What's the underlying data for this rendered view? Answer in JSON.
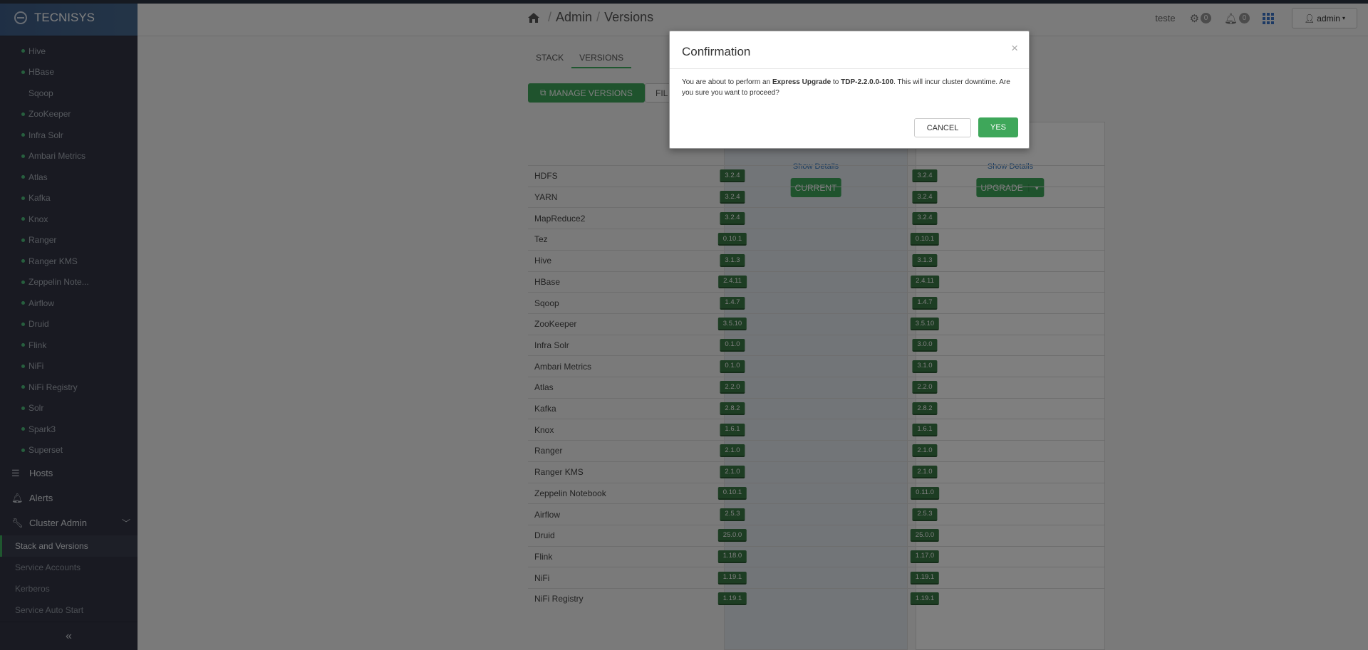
{
  "brand": {
    "name": "TECNISYS"
  },
  "sidebar": {
    "services": [
      {
        "label": "Hive",
        "dot": true
      },
      {
        "label": "HBase",
        "dot": true
      },
      {
        "label": "Sqoop",
        "dot": false
      },
      {
        "label": "ZooKeeper",
        "dot": true
      },
      {
        "label": "Infra Solr",
        "dot": true
      },
      {
        "label": "Ambari Metrics",
        "dot": true
      },
      {
        "label": "Atlas",
        "dot": true
      },
      {
        "label": "Kafka",
        "dot": true
      },
      {
        "label": "Knox",
        "dot": true
      },
      {
        "label": "Ranger",
        "dot": true
      },
      {
        "label": "Ranger KMS",
        "dot": true
      },
      {
        "label": "Zeppelin Note...",
        "dot": true
      },
      {
        "label": "Airflow",
        "dot": true
      },
      {
        "label": "Druid",
        "dot": true
      },
      {
        "label": "Flink",
        "dot": true
      },
      {
        "label": "NiFi",
        "dot": true
      },
      {
        "label": "NiFi Registry",
        "dot": true
      },
      {
        "label": "Solr",
        "dot": true
      },
      {
        "label": "Spark3",
        "dot": true
      },
      {
        "label": "Superset",
        "dot": true
      }
    ],
    "hosts": "Hosts",
    "alerts": "Alerts",
    "cluster_admin": "Cluster Admin",
    "cluster_admin_items": [
      "Stack and Versions",
      "Service Accounts",
      "Kerberos",
      "Service Auto Start"
    ],
    "collapse_icon": "double-chevron-left-icon"
  },
  "topbar": {
    "breadcrumb": [
      "Admin",
      "Versions"
    ],
    "username": "teste",
    "ops_count": "0",
    "alerts_count": "0",
    "admin_label": "admin"
  },
  "tabs": [
    "STACK",
    "VERSIONS"
  ],
  "manage_versions": "MANAGE VERSIONS",
  "filter_label": "FIL",
  "columns": {
    "current": {
      "show_details": "Show Details",
      "button": "CURRENT"
    },
    "upgrade": {
      "show_details": "Show Details",
      "button": "UPGRADE"
    }
  },
  "rows": [
    {
      "service": "HDFS",
      "current": "3.2.4",
      "upgrade": "3.2.4"
    },
    {
      "service": "YARN",
      "current": "3.2.4",
      "upgrade": "3.2.4"
    },
    {
      "service": "MapReduce2",
      "current": "3.2.4",
      "upgrade": "3.2.4"
    },
    {
      "service": "Tez",
      "current": "0.10.1",
      "upgrade": "0.10.1"
    },
    {
      "service": "Hive",
      "current": "3.1.3",
      "upgrade": "3.1.3"
    },
    {
      "service": "HBase",
      "current": "2.4.11",
      "upgrade": "2.4.11"
    },
    {
      "service": "Sqoop",
      "current": "1.4.7",
      "upgrade": "1.4.7"
    },
    {
      "service": "ZooKeeper",
      "current": "3.5.10",
      "upgrade": "3.5.10"
    },
    {
      "service": "Infra Solr",
      "current": "0.1.0",
      "upgrade": "3.0.0"
    },
    {
      "service": "Ambari Metrics",
      "current": "0.1.0",
      "upgrade": "3.1.0"
    },
    {
      "service": "Atlas",
      "current": "2.2.0",
      "upgrade": "2.2.0"
    },
    {
      "service": "Kafka",
      "current": "2.8.2",
      "upgrade": "2.8.2"
    },
    {
      "service": "Knox",
      "current": "1.6.1",
      "upgrade": "1.6.1"
    },
    {
      "service": "Ranger",
      "current": "2.1.0",
      "upgrade": "2.1.0"
    },
    {
      "service": "Ranger KMS",
      "current": "2.1.0",
      "upgrade": "2.1.0"
    },
    {
      "service": "Zeppelin Notebook",
      "current": "0.10.1",
      "upgrade": "0.11.0"
    },
    {
      "service": "Airflow",
      "current": "2.5.3",
      "upgrade": "2.5.3"
    },
    {
      "service": "Druid",
      "current": "25.0.0",
      "upgrade": "25.0.0"
    },
    {
      "service": "Flink",
      "current": "1.18.0",
      "upgrade": "1.17.0"
    },
    {
      "service": "NiFi",
      "current": "1.19.1",
      "upgrade": "1.19.1"
    },
    {
      "service": "NiFi Registry",
      "current": "1.19.1",
      "upgrade": "1.19.1"
    }
  ],
  "modal": {
    "title": "Confirmation",
    "close": "×",
    "text_1": "You are about to perform an ",
    "express": "Express Upgrade",
    "text_2": " to ",
    "version": "TDP-2.2.0.0-100",
    "text_3": ". This will incur cluster downtime. Are you sure you want to proceed?",
    "cancel": "CANCEL",
    "yes": "YES"
  }
}
